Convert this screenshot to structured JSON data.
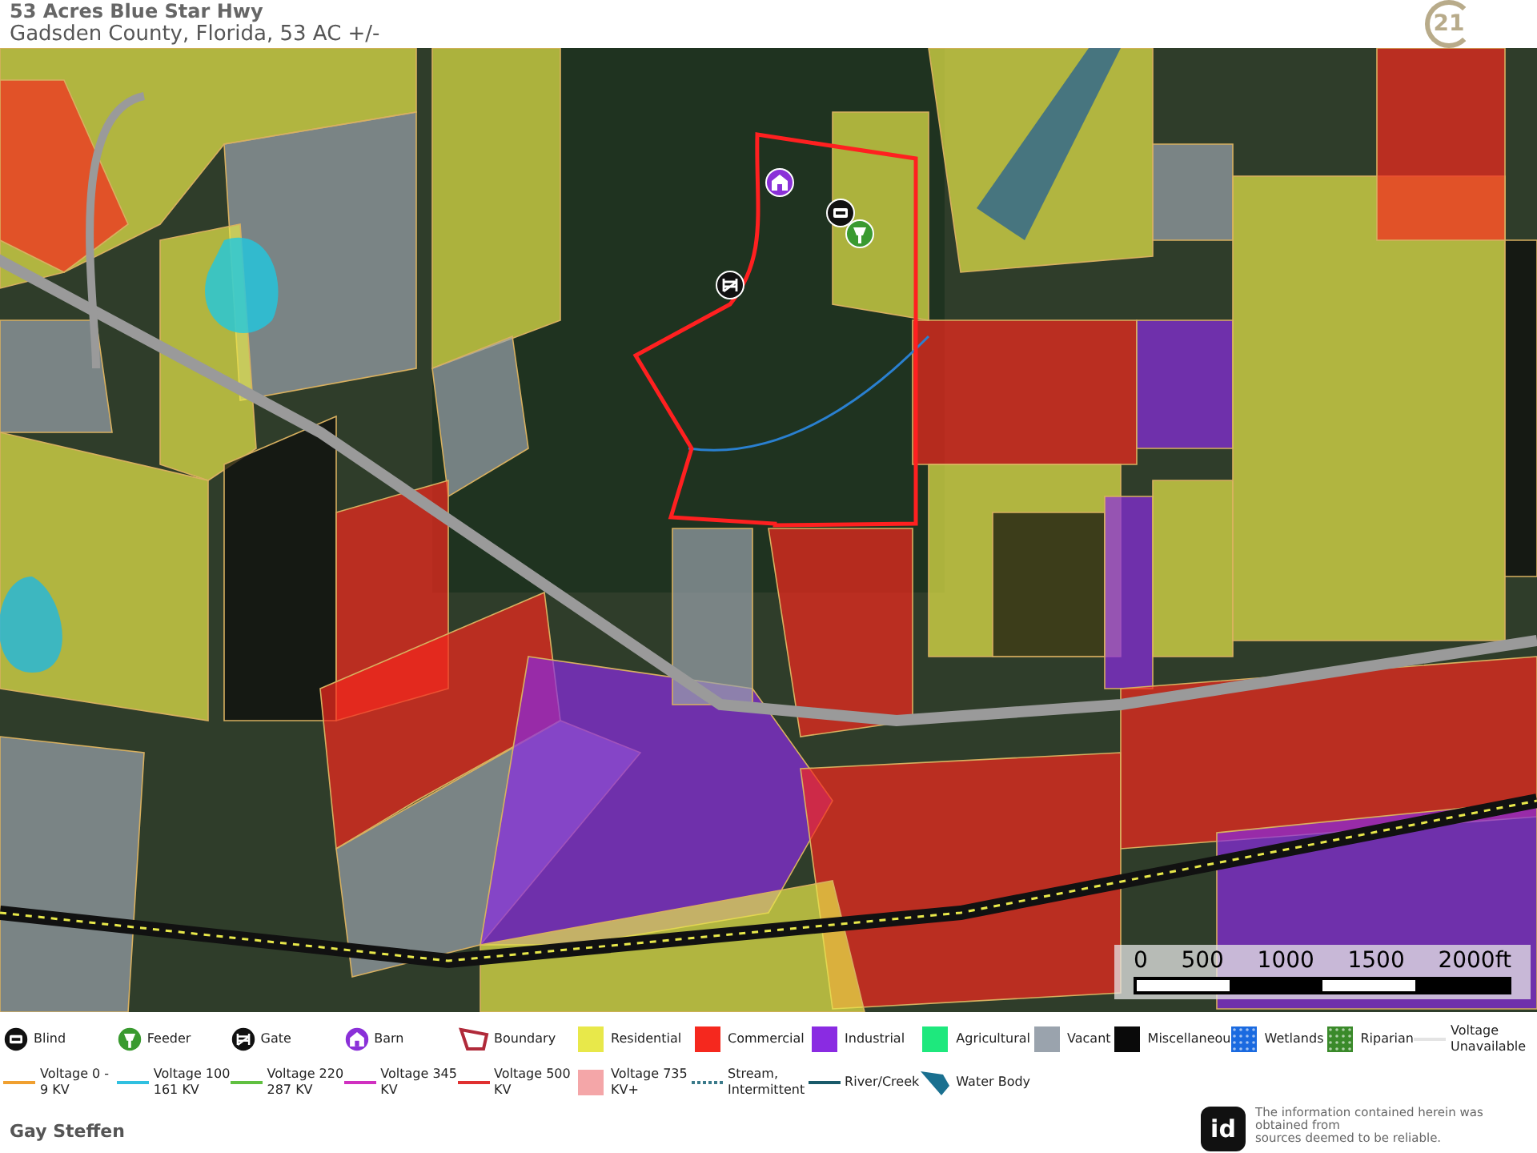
{
  "header": {
    "title": "53 Acres Blue Star Hwy",
    "subtitle": "Gadsden County, Florida, 53 AC +/-",
    "logo_text": "21"
  },
  "map": {
    "scale_bar": {
      "labels": [
        "0",
        "500",
        "1000",
        "1500",
        "2000ft"
      ]
    }
  },
  "legend": {
    "items": [
      {
        "label": "Blind",
        "kind": "blind",
        "color": "#111111"
      },
      {
        "label": "Feeder",
        "kind": "feeder",
        "color": "#3a9a30"
      },
      {
        "label": "Gate",
        "kind": "gate",
        "color": "#111111"
      },
      {
        "label": "Barn",
        "kind": "barn",
        "color": "#8a30d8"
      },
      {
        "label": "Boundary",
        "kind": "boundary",
        "color": "#b02a3a"
      },
      {
        "label": "Residential",
        "kind": "fill",
        "color": "#e8e84a"
      },
      {
        "label": "Commercial",
        "kind": "fill",
        "color": "#f5281e"
      },
      {
        "label": "Industrial",
        "kind": "fill",
        "color": "#8a2be2"
      },
      {
        "label": "Agricultural",
        "kind": "fill",
        "color": "#1ee87d"
      },
      {
        "label": "Vacant",
        "kind": "fill",
        "color": "#9aa3ad"
      },
      {
        "label": "Miscellaneou",
        "kind": "fill",
        "color": "#0a0a0a"
      },
      {
        "label": "Wetlands",
        "kind": "pattern",
        "color": "#1a6ae0"
      },
      {
        "label": "Riparian",
        "kind": "pattern",
        "color": "#3a8a2a"
      },
      {
        "label": "Voltage Unavailable",
        "kind": "line",
        "color": "#e4e4e4"
      },
      {
        "label": "Voltage 0 - 9 KV",
        "kind": "line",
        "color": "#f0a030"
      },
      {
        "label": "Voltage 100 161 KV",
        "kind": "line",
        "color": "#30c0e0"
      },
      {
        "label": "Voltage 220 287 KV",
        "kind": "line",
        "color": "#60c040"
      },
      {
        "label": "Voltage 345 KV",
        "kind": "line",
        "color": "#d030c0"
      },
      {
        "label": "Voltage 500 KV",
        "kind": "line",
        "color": "#e03030"
      },
      {
        "label": "Voltage  735 KV+",
        "kind": "fill",
        "color": "#f4a6a8"
      },
      {
        "label": "Stream, Intermittent",
        "kind": "dotted",
        "color": "#3a7a8a"
      },
      {
        "label": "River/Creek",
        "kind": "line",
        "color": "#1a5a6a"
      },
      {
        "label": "Water Body",
        "kind": "water",
        "color": "#1a7090"
      }
    ]
  },
  "footer": {
    "agent": "Gay Steffen",
    "logo_text": "id",
    "disclaimer": [
      "The information contained herein was obtained from",
      "sources deemed to be reliable."
    ]
  }
}
